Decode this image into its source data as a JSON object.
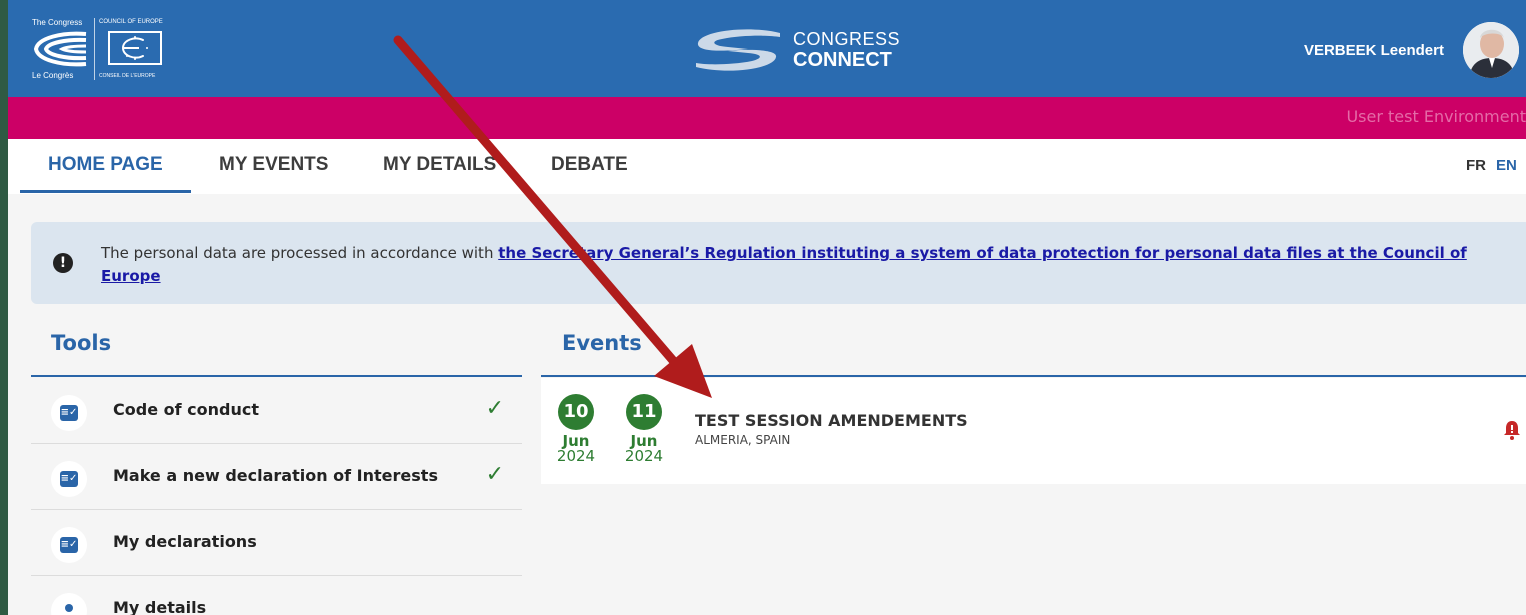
{
  "header": {
    "logo": {
      "line1": "The Congress",
      "line2": "COUNCIL OF EUROPE",
      "line3": "Le Congrès",
      "line4": "CONSEIL DE L'EUROPE"
    },
    "brand_line1": "CONGRESS",
    "brand_line2": "CONNECT",
    "user_name": "VERBEEK Leendert"
  },
  "env_banner": "User test Environment",
  "nav": {
    "tabs": [
      {
        "label": "HOME PAGE",
        "active": true
      },
      {
        "label": "MY EVENTS",
        "active": false
      },
      {
        "label": "MY DETAILS",
        "active": false
      },
      {
        "label": "DEBATE",
        "active": false
      }
    ],
    "languages": [
      "FR",
      "EN"
    ]
  },
  "notice": {
    "text": "The personal data are processed in accordance with ",
    "link": "the Secretary General’s Regulation instituting a system of data protection for personal data files at the Council of Europe"
  },
  "tools": {
    "title": "Tools",
    "items": [
      {
        "label": "Code of conduct",
        "done": true,
        "icon": "checklist-icon"
      },
      {
        "label": "Make a new declaration of Interests",
        "done": true,
        "icon": "checklist-icon"
      },
      {
        "label": "My declarations",
        "done": false,
        "icon": "checklist-icon"
      },
      {
        "label": "My details",
        "done": false,
        "icon": "person-icon"
      }
    ]
  },
  "events": {
    "title": "Events",
    "items": [
      {
        "start": {
          "day": "10",
          "month": "Jun",
          "year": "2024"
        },
        "end": {
          "day": "11",
          "month": "Jun",
          "year": "2024"
        },
        "title": "TEST SESSION AMENDEMENTS",
        "location": "ALMERIA, SPAIN",
        "alert_icon": "bell-alert-icon"
      }
    ]
  },
  "colors": {
    "header_blue": "#2a6bb0",
    "banner_magenta": "#cc0066",
    "accent_blue": "#2a65a8",
    "success_green": "#2e7d32",
    "arrow_red": "#b01c1c"
  }
}
